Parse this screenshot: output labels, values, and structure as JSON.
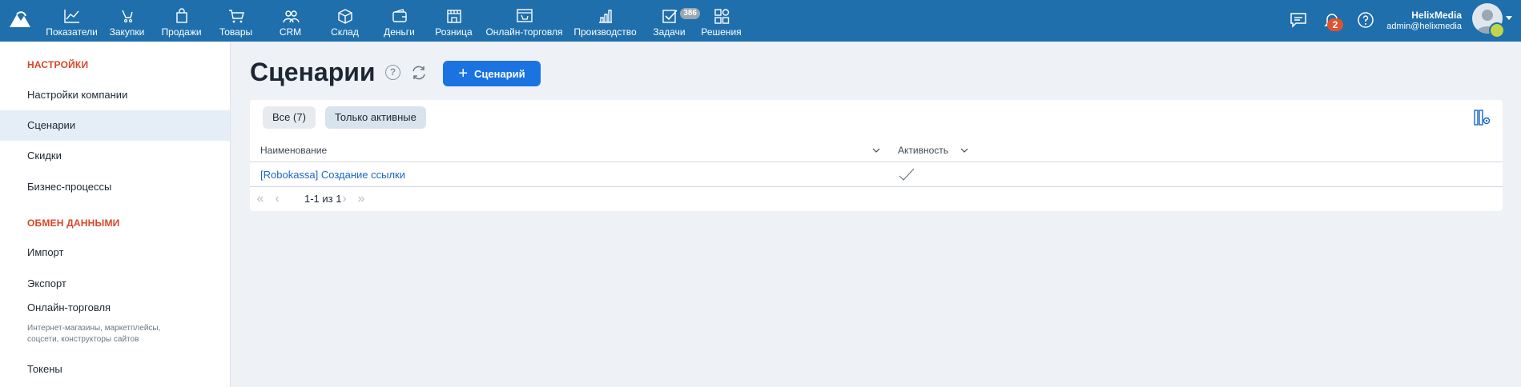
{
  "topbar": {
    "nav": [
      {
        "label": "Показатели",
        "icon": "chart-line-icon"
      },
      {
        "label": "Закупки",
        "icon": "purchase-icon"
      },
      {
        "label": "Продажи",
        "icon": "bag-icon"
      },
      {
        "label": "Товары",
        "icon": "cart-icon"
      },
      {
        "label": "CRM",
        "icon": "people-icon"
      },
      {
        "label": "Склад",
        "icon": "box-icon"
      },
      {
        "label": "Деньги",
        "icon": "wallet-icon"
      },
      {
        "label": "Розница",
        "icon": "store-icon"
      },
      {
        "label": "Онлайн-торговля",
        "icon": "online-store-icon"
      },
      {
        "label": "Производство",
        "icon": "factory-icon"
      },
      {
        "label": "Задачи",
        "icon": "tasks-icon",
        "badge": "386"
      },
      {
        "label": "Решения",
        "icon": "apps-icon"
      }
    ],
    "notifications_count": "2",
    "user": {
      "name": "HelixMedia",
      "email": "admin@helixmedia"
    }
  },
  "sidebar": {
    "heading_settings": "НАСТРОЙКИ",
    "settings_items": [
      "Настройки компании",
      "Сценарии",
      "Скидки",
      "Бизнес-процессы"
    ],
    "heading_exchange": "ОБМЕН ДАННЫМИ",
    "exchange_items": [
      "Импорт",
      "Экспорт",
      "Онлайн-торговля"
    ],
    "online_sub": "Интернет-магазины, маркетплейсы, соцсети, конструкторы сайтов",
    "tokens": "Токены",
    "active_item": "Сценарии"
  },
  "main": {
    "title": "Сценарии",
    "help": "?",
    "add_button": "Сценарий",
    "filters": {
      "all": "Все (7)",
      "active": "Только активные"
    },
    "columns": {
      "name": "Наименование",
      "activity": "Активность"
    },
    "rows": [
      {
        "name": "[Robokassa] Создание ссылки",
        "active": true
      }
    ],
    "pager": "1-1 из 1"
  },
  "colors": {
    "topbar": "#1f6fad",
    "accent": "#1a73e0",
    "heading": "#d9452b",
    "link": "#1a66c8"
  }
}
